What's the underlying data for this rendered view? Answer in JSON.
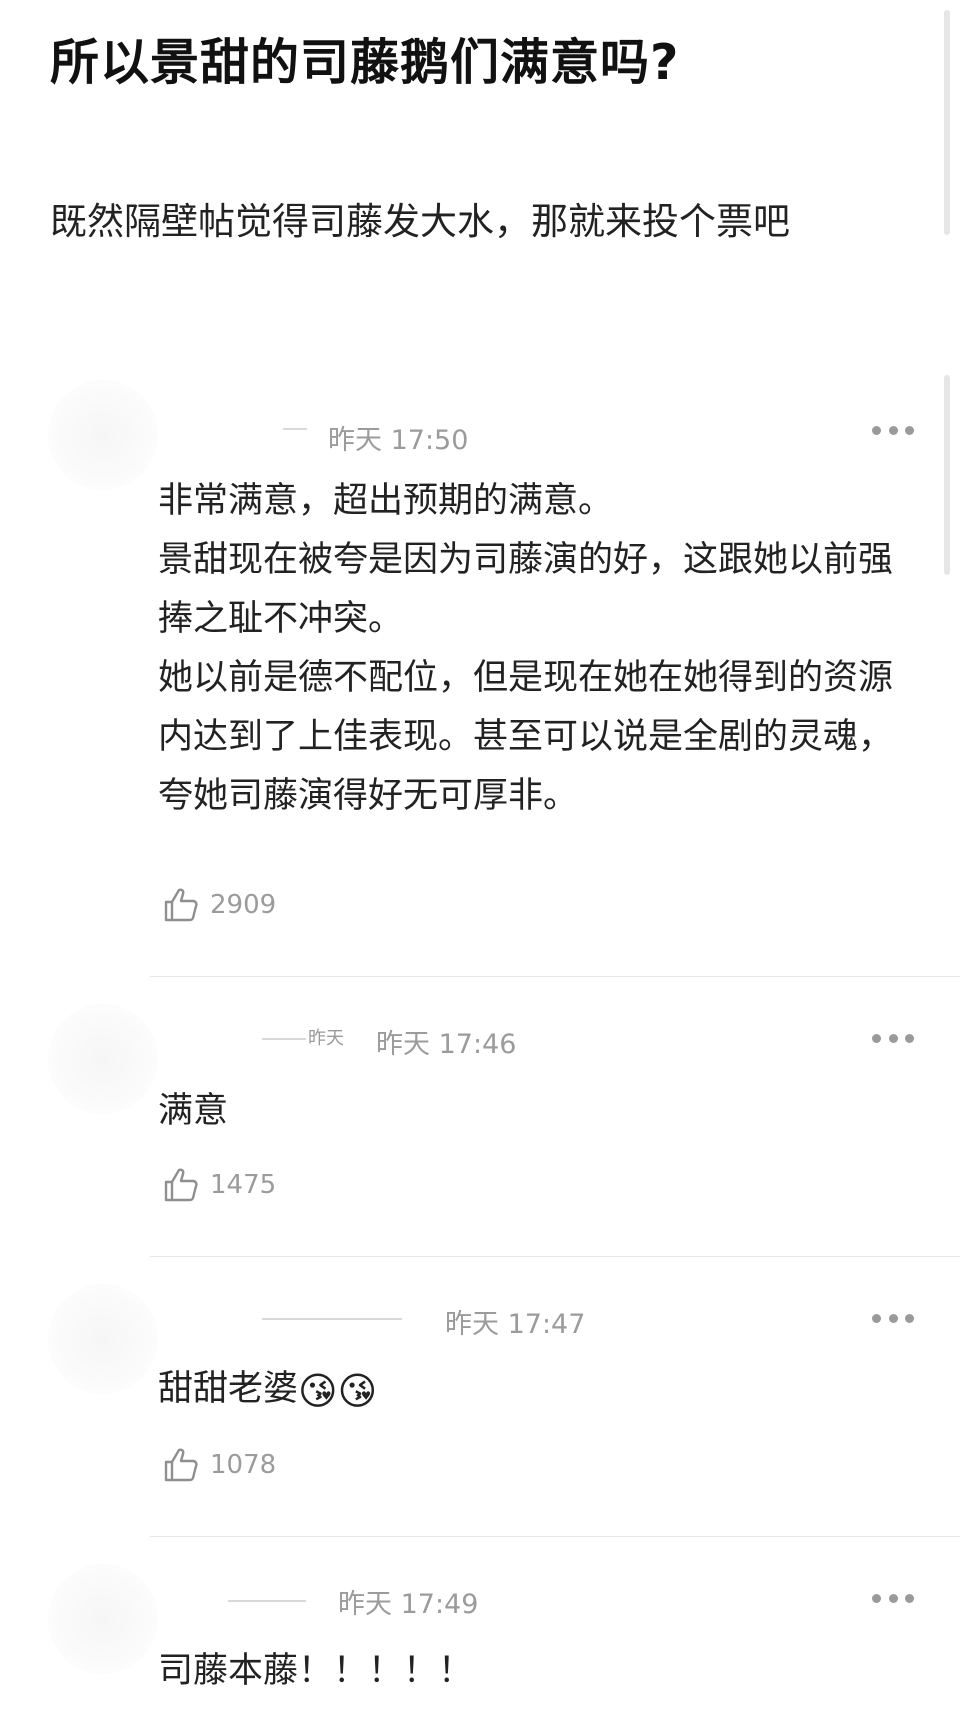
{
  "post": {
    "title": "所以景甜的司藤鹅们满意吗?",
    "body": "既然隔壁帖觉得司藤发大水，那就来投个票吧"
  },
  "icons": {
    "like": "thumbs-up-icon",
    "more": "more-dots-icon"
  },
  "comments": [
    {
      "user_partial": "",
      "time": "昨天 17:50",
      "text": "非常满意，超出预期的满意。\n景甜现在被夸是因为司藤演的好，这跟她以前强捧之耻不冲突。\n她以前是德不配位，但是现在她在她得到的资源内达到了上佳表现。甚至可以说是全剧的灵魂，夸她司藤演得好无可厚非。",
      "likes": "2909"
    },
    {
      "user_partial": "昨天",
      "time": "昨天 17:46",
      "text": "满意",
      "likes": "1475"
    },
    {
      "user_partial": "",
      "time": "昨天 17:47",
      "text": "甜甜老婆",
      "emoji": "😘😘",
      "likes": "1078"
    },
    {
      "user_partial": "",
      "time": "昨天 17:49",
      "text": "司藤本藤！！！！！",
      "likes": ""
    }
  ]
}
